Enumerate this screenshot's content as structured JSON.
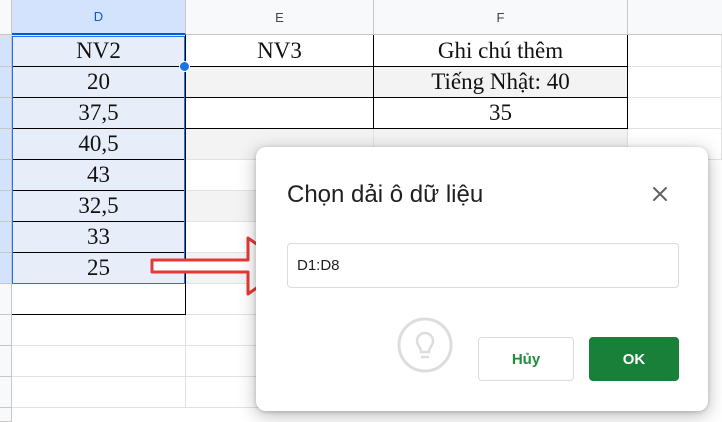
{
  "columns": [
    {
      "label": "D",
      "selected": true
    },
    {
      "label": "E",
      "selected": false
    },
    {
      "label": "F",
      "selected": false
    }
  ],
  "cells": {
    "D1": "NV2",
    "E1": "NV3",
    "F1": "Ghi chú thêm",
    "D2": "20",
    "E2": "",
    "F2": "Tiếng Nhật: 40",
    "D3": "37,5",
    "E3": "",
    "F3": "35",
    "D4": "40,5",
    "D5": "43",
    "D6": "32,5",
    "D7": "33",
    "D8": "25"
  },
  "dialog": {
    "title": "Chọn dải ô dữ liệu",
    "range_value": "D1:D8",
    "cancel_label": "Hủy",
    "ok_label": "OK"
  },
  "icons": {
    "close": "close-icon",
    "arrow": "red-arrow-annotation",
    "watermark": "quantrimang-logo"
  },
  "colors": {
    "selection": "#1a73e8",
    "ok_button": "#188038",
    "annotation_arrow": "#e53935"
  }
}
